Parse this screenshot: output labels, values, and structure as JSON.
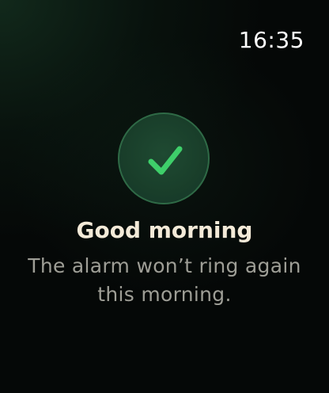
{
  "status_bar": {
    "time": "16:35"
  },
  "confirmation": {
    "icon": "checkmark-icon",
    "accent_color": "#3ecf6a",
    "title": "Good morning",
    "message": "The alarm won’t ring again this morning."
  }
}
